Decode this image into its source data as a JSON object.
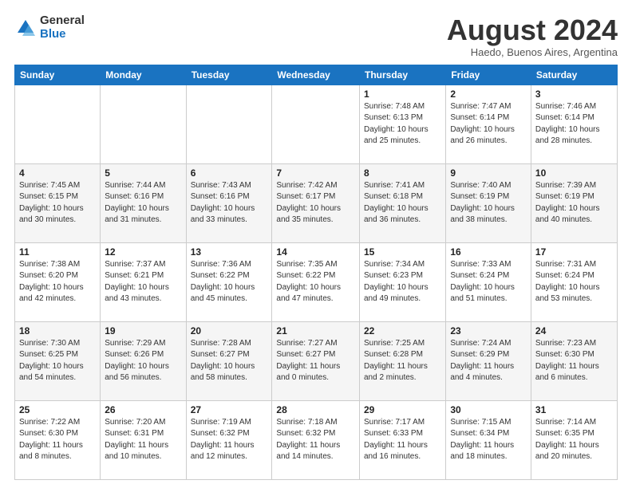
{
  "logo": {
    "general": "General",
    "blue": "Blue"
  },
  "header": {
    "title": "August 2024",
    "subtitle": "Haedo, Buenos Aires, Argentina"
  },
  "days_of_week": [
    "Sunday",
    "Monday",
    "Tuesday",
    "Wednesday",
    "Thursday",
    "Friday",
    "Saturday"
  ],
  "weeks": [
    [
      {
        "day": "",
        "info": ""
      },
      {
        "day": "",
        "info": ""
      },
      {
        "day": "",
        "info": ""
      },
      {
        "day": "",
        "info": ""
      },
      {
        "day": "1",
        "info": "Sunrise: 7:48 AM\nSunset: 6:13 PM\nDaylight: 10 hours\nand 25 minutes."
      },
      {
        "day": "2",
        "info": "Sunrise: 7:47 AM\nSunset: 6:14 PM\nDaylight: 10 hours\nand 26 minutes."
      },
      {
        "day": "3",
        "info": "Sunrise: 7:46 AM\nSunset: 6:14 PM\nDaylight: 10 hours\nand 28 minutes."
      }
    ],
    [
      {
        "day": "4",
        "info": "Sunrise: 7:45 AM\nSunset: 6:15 PM\nDaylight: 10 hours\nand 30 minutes."
      },
      {
        "day": "5",
        "info": "Sunrise: 7:44 AM\nSunset: 6:16 PM\nDaylight: 10 hours\nand 31 minutes."
      },
      {
        "day": "6",
        "info": "Sunrise: 7:43 AM\nSunset: 6:16 PM\nDaylight: 10 hours\nand 33 minutes."
      },
      {
        "day": "7",
        "info": "Sunrise: 7:42 AM\nSunset: 6:17 PM\nDaylight: 10 hours\nand 35 minutes."
      },
      {
        "day": "8",
        "info": "Sunrise: 7:41 AM\nSunset: 6:18 PM\nDaylight: 10 hours\nand 36 minutes."
      },
      {
        "day": "9",
        "info": "Sunrise: 7:40 AM\nSunset: 6:19 PM\nDaylight: 10 hours\nand 38 minutes."
      },
      {
        "day": "10",
        "info": "Sunrise: 7:39 AM\nSunset: 6:19 PM\nDaylight: 10 hours\nand 40 minutes."
      }
    ],
    [
      {
        "day": "11",
        "info": "Sunrise: 7:38 AM\nSunset: 6:20 PM\nDaylight: 10 hours\nand 42 minutes."
      },
      {
        "day": "12",
        "info": "Sunrise: 7:37 AM\nSunset: 6:21 PM\nDaylight: 10 hours\nand 43 minutes."
      },
      {
        "day": "13",
        "info": "Sunrise: 7:36 AM\nSunset: 6:22 PM\nDaylight: 10 hours\nand 45 minutes."
      },
      {
        "day": "14",
        "info": "Sunrise: 7:35 AM\nSunset: 6:22 PM\nDaylight: 10 hours\nand 47 minutes."
      },
      {
        "day": "15",
        "info": "Sunrise: 7:34 AM\nSunset: 6:23 PM\nDaylight: 10 hours\nand 49 minutes."
      },
      {
        "day": "16",
        "info": "Sunrise: 7:33 AM\nSunset: 6:24 PM\nDaylight: 10 hours\nand 51 minutes."
      },
      {
        "day": "17",
        "info": "Sunrise: 7:31 AM\nSunset: 6:24 PM\nDaylight: 10 hours\nand 53 minutes."
      }
    ],
    [
      {
        "day": "18",
        "info": "Sunrise: 7:30 AM\nSunset: 6:25 PM\nDaylight: 10 hours\nand 54 minutes."
      },
      {
        "day": "19",
        "info": "Sunrise: 7:29 AM\nSunset: 6:26 PM\nDaylight: 10 hours\nand 56 minutes."
      },
      {
        "day": "20",
        "info": "Sunrise: 7:28 AM\nSunset: 6:27 PM\nDaylight: 10 hours\nand 58 minutes."
      },
      {
        "day": "21",
        "info": "Sunrise: 7:27 AM\nSunset: 6:27 PM\nDaylight: 11 hours\nand 0 minutes."
      },
      {
        "day": "22",
        "info": "Sunrise: 7:25 AM\nSunset: 6:28 PM\nDaylight: 11 hours\nand 2 minutes."
      },
      {
        "day": "23",
        "info": "Sunrise: 7:24 AM\nSunset: 6:29 PM\nDaylight: 11 hours\nand 4 minutes."
      },
      {
        "day": "24",
        "info": "Sunrise: 7:23 AM\nSunset: 6:30 PM\nDaylight: 11 hours\nand 6 minutes."
      }
    ],
    [
      {
        "day": "25",
        "info": "Sunrise: 7:22 AM\nSunset: 6:30 PM\nDaylight: 11 hours\nand 8 minutes."
      },
      {
        "day": "26",
        "info": "Sunrise: 7:20 AM\nSunset: 6:31 PM\nDaylight: 11 hours\nand 10 minutes."
      },
      {
        "day": "27",
        "info": "Sunrise: 7:19 AM\nSunset: 6:32 PM\nDaylight: 11 hours\nand 12 minutes."
      },
      {
        "day": "28",
        "info": "Sunrise: 7:18 AM\nSunset: 6:32 PM\nDaylight: 11 hours\nand 14 minutes."
      },
      {
        "day": "29",
        "info": "Sunrise: 7:17 AM\nSunset: 6:33 PM\nDaylight: 11 hours\nand 16 minutes."
      },
      {
        "day": "30",
        "info": "Sunrise: 7:15 AM\nSunset: 6:34 PM\nDaylight: 11 hours\nand 18 minutes."
      },
      {
        "day": "31",
        "info": "Sunrise: 7:14 AM\nSunset: 6:35 PM\nDaylight: 11 hours\nand 20 minutes."
      }
    ]
  ]
}
